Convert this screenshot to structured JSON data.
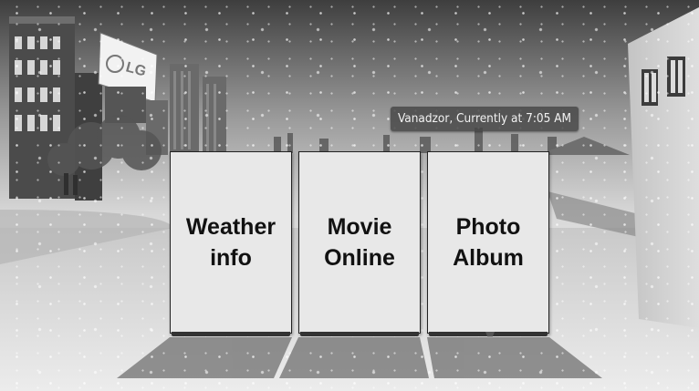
{
  "scene": {
    "location_banner": "Vanadzor, Currently at 7:05 AM",
    "billboard_logo": "LG"
  },
  "menu": {
    "cards": [
      {
        "label": "Weather\ninfo"
      },
      {
        "label": "Movie\nOnline"
      },
      {
        "label": "Photo\nAlbum"
      }
    ]
  },
  "colors": {
    "card_face": "#e8e8e8",
    "card_border": "#222222",
    "banner_bg": "#464646",
    "banner_text": "#f2f2f2"
  }
}
